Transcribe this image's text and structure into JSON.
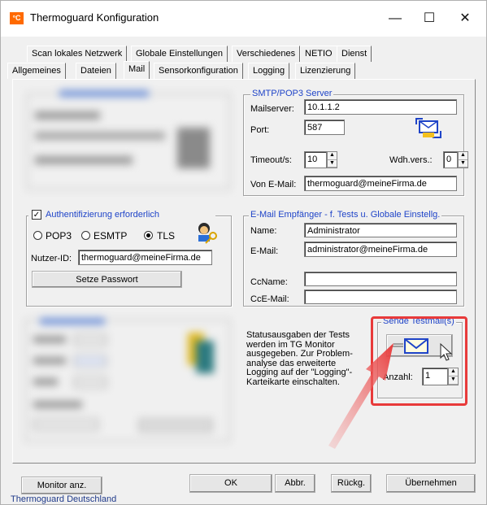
{
  "window": {
    "app_icon_text": "°C",
    "title": "Thermoguard Konfiguration",
    "minimize": "—",
    "maximize": "☐",
    "close": "✕"
  },
  "tabs_row1": [
    "Scan lokales Netzwerk",
    "Globale Einstellungen",
    "Verschiedenes",
    "NETIO",
    "Dienst"
  ],
  "tabs_row2": [
    "Allgemeines",
    "Dateien",
    "Mail",
    "Sensorkonfiguration",
    "Logging",
    "Lizenzierung"
  ],
  "active_tab": "Mail",
  "smtp": {
    "title": "SMTP/POP3 Server",
    "mailserver_label": "Mailserver:",
    "mailserver_value": "10.1.1.2",
    "port_label": "Port:",
    "port_value": "587",
    "timeout_label": "Timeout/s:",
    "timeout_value": "10",
    "wdh_label": "Wdh.vers.:",
    "wdh_value": "0",
    "from_label": "Von E-Mail:",
    "from_value": "thermoguard@meineFirma.de"
  },
  "auth": {
    "checkbox_label": "Authentifizierung erforderlich",
    "checked": true,
    "radio_pop3": "POP3",
    "radio_esmtp": "ESMTP",
    "radio_tls": "TLS",
    "selected": "TLS",
    "user_label": "Nutzer-ID:",
    "user_value": "thermoguard@meineFirma.de",
    "set_password": "Setze Passwort"
  },
  "recipient": {
    "title": "E-Mail Empfänger - f. Tests u. Globale Einstellg.",
    "name_label": "Name:",
    "name_value": "Administrator",
    "email_label": "E-Mail:",
    "email_value": "administrator@meineFirma.de",
    "ccname_label": "CcName:",
    "ccname_value": "",
    "ccemail_label": "CcE-Mail:",
    "ccemail_value": ""
  },
  "status_text": "Statusausgaben der Tests werden im TG Monitor ausgegeben. Zur Problem-analyse das erweiterte Logging auf der \"Logging\"-Karteikarte einschalten.",
  "testmail": {
    "title": "Sende Testmail(s)",
    "count_label": "Anzahl:",
    "count_value": "1"
  },
  "buttons": {
    "monitor": "Monitor anz.",
    "ok": "OK",
    "abbr": "Abbr.",
    "rueckg": "Rückg.",
    "uebernehmen": "Übernehmen"
  },
  "footer_text": "Thermoguard Deutschland",
  "colors": {
    "highlight": "#e83a3a",
    "group_title": "#1f44c8",
    "titlebar": "#ffffff"
  }
}
